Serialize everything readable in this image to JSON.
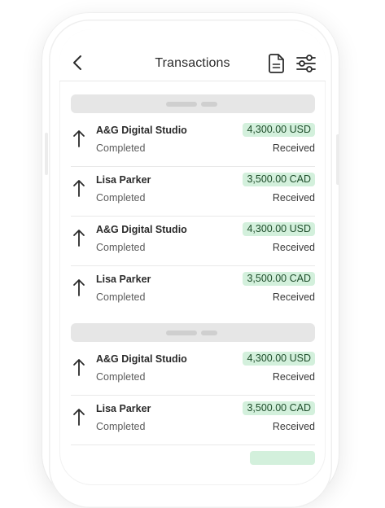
{
  "header": {
    "title": "Transactions",
    "back_icon": "chevron-left-icon",
    "document_icon": "document-icon",
    "filter_icon": "sliders-icon"
  },
  "colors": {
    "amount_badge_bg": "#d3f0dc",
    "amount_badge_text": "#1f4d2b",
    "group_header_bg": "#e6e6e6"
  },
  "groups": [
    {
      "transactions": [
        {
          "name": "A&G Digital Studio",
          "status": "Completed",
          "amount": "4,300.00 USD",
          "direction": "Received",
          "icon": "arrow-up-icon"
        },
        {
          "name": "Lisa Parker",
          "status": "Completed",
          "amount": "3,500.00 CAD",
          "direction": "Received",
          "icon": "arrow-up-icon"
        },
        {
          "name": "A&G Digital Studio",
          "status": "Completed",
          "amount": "4,300.00 USD",
          "direction": "Received",
          "icon": "arrow-up-icon"
        },
        {
          "name": "Lisa Parker",
          "status": "Completed",
          "amount": "3,500.00 CAD",
          "direction": "Received",
          "icon": "arrow-up-icon"
        }
      ]
    },
    {
      "transactions": [
        {
          "name": "A&G Digital Studio",
          "status": "Completed",
          "amount": "4,300.00 USD",
          "direction": "Received",
          "icon": "arrow-up-icon"
        },
        {
          "name": "Lisa Parker",
          "status": "Completed",
          "amount": "3,500.00 CAD",
          "direction": "Received",
          "icon": "arrow-up-icon"
        }
      ]
    }
  ]
}
